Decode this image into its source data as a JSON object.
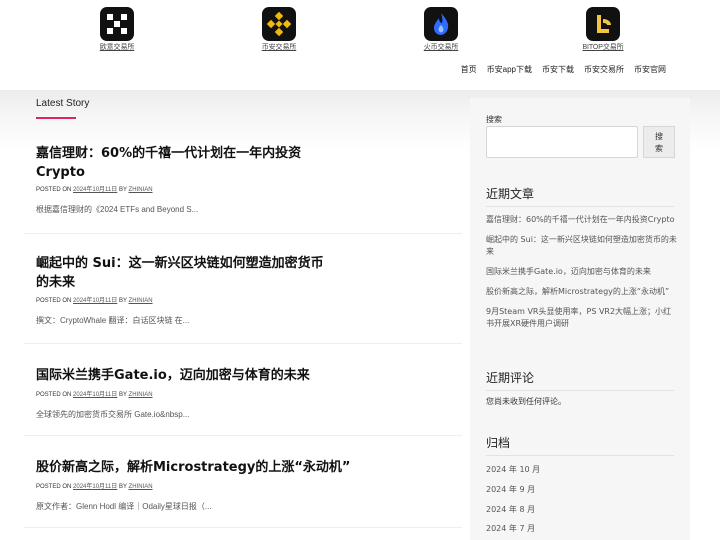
{
  "exchanges": [
    {
      "label": "欧意交易所",
      "icon": "okx-logo-icon"
    },
    {
      "label": "币安交易所",
      "icon": "binance-logo-icon"
    },
    {
      "label": "火币交易所",
      "icon": "huobi-logo-icon"
    },
    {
      "label": "BITOP交易所",
      "icon": "bitop-logo-icon"
    }
  ],
  "nav": [
    "首页",
    "币安app下载",
    "币安下载",
    "币安交易所",
    "币安官网"
  ],
  "main": {
    "section_label": "Latest Story",
    "posts": [
      {
        "title": "嘉信理财：60%的千禧一代计划在一年内投资Crypto",
        "meta_prefix": "POSTED ON",
        "date": "2024年10月11日",
        "by": "BY",
        "author": "ZHINIAN",
        "excerpt": "根据嘉信理财的《2024 ETFs and Beyond S..."
      },
      {
        "title": "崛起中的 Sui：这一新兴区块链如何塑造加密货币的未来",
        "meta_prefix": "POSTED ON",
        "date": "2024年10月11日",
        "by": "BY",
        "author": "ZHINIAN",
        "excerpt": "撰文：CryptoWhale 翻译：白话区块链 在..."
      },
      {
        "title": "国际米兰携手Gate.io，迈向加密与体育的未来",
        "meta_prefix": "POSTED ON",
        "date": "2024年10月11日",
        "by": "BY",
        "author": "ZHINIAN",
        "excerpt": "全球领先的加密货币交易所 Gate.io&nbsp..."
      },
      {
        "title": "股价新高之际，解析Microstrategy的上涨“永动机”",
        "meta_prefix": "POSTED ON",
        "date": "2024年10月11日",
        "by": "BY",
        "author": "ZHINIAN",
        "excerpt": "原文作者：Glenn Hodl 编译｜Odaily星球日报（..."
      }
    ]
  },
  "sidebar": {
    "search_label": "搜索",
    "search_value": "",
    "search_button": "搜索",
    "recent_posts_heading": "近期文章",
    "recent_posts": [
      "嘉信理财：60%的千禧一代计划在一年内投资Crypto",
      "崛起中的 Sui：这一新兴区块链如何塑造加密货币的未来",
      "国际米兰携手Gate.io，迈向加密与体育的未来",
      "股价新高之际，解析Microstrategy的上涨“永动机”",
      "9月Steam VR头显使用率，PS VR2大幅上涨；小红书开展XR硬件用户调研"
    ],
    "recent_comments_heading": "近期评论",
    "no_comments": "您尚未收到任何评论。",
    "archives_heading": "归档",
    "archives": [
      "2024 年 10 月",
      "2024 年 9 月",
      "2024 年 8 月",
      "2024 年 7 月"
    ]
  },
  "colors": {
    "accent": "#e0245e",
    "binance_yellow": "#f0b90b",
    "huobi_blue": "#2f6bff",
    "bitop_gold": "#f5c542"
  }
}
